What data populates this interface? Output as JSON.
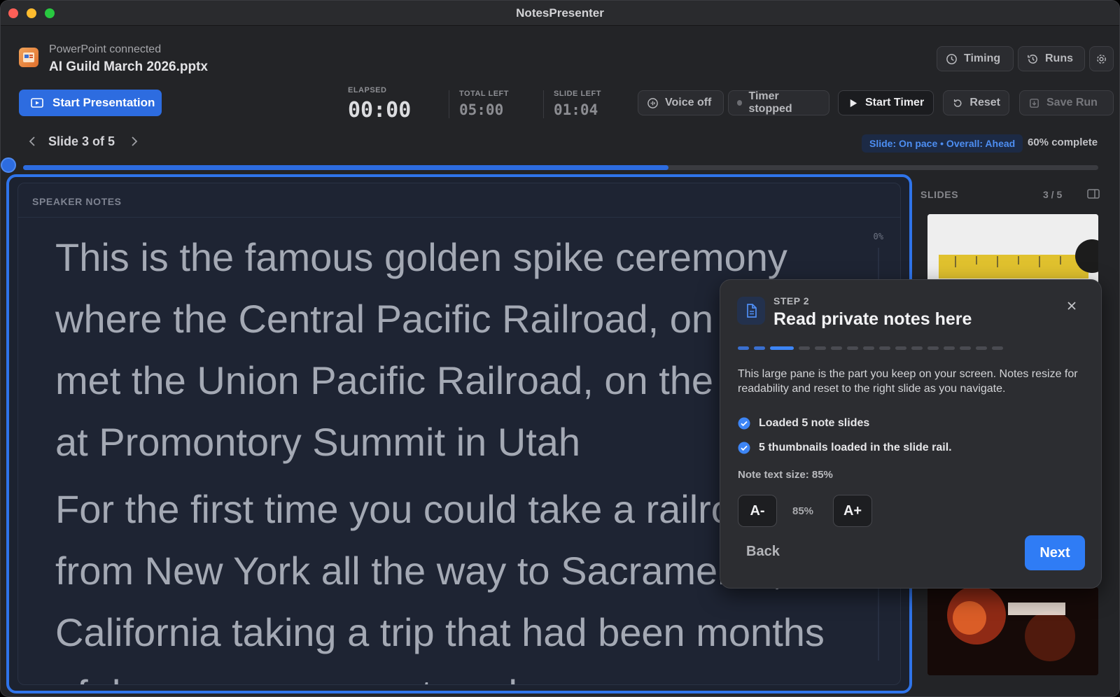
{
  "window": {
    "title": "NotesPresenter"
  },
  "header": {
    "connection_status": "PowerPoint connected",
    "file_name": "AI Guild March 2026.pptx",
    "start_presentation_label": "Start Presentation",
    "timing_label": "Timing",
    "runs_label": "Runs"
  },
  "timers": {
    "elapsed_label": "ELAPSED",
    "elapsed_value": "00:00",
    "total_left_label": "TOTAL LEFT",
    "total_left_value": "05:00",
    "slide_left_label": "SLIDE LEFT",
    "slide_left_value": "01:04"
  },
  "controls": {
    "voice_label": "Voice off",
    "timer_status": "Timer stopped",
    "start_timer_label": "Start Timer",
    "reset_label": "Reset",
    "save_run_label": "Save Run"
  },
  "navigation": {
    "slide_counter": "Slide 3 of 5",
    "pace_status": "Slide: On pace • Overall: Ahead",
    "complete_text": "60% complete",
    "progress_fraction": 0.6
  },
  "notes": {
    "title": "SPEAKER NOTES",
    "scroll_percent": "0%",
    "paragraphs": [
      "This is the famous golden spike ceremony where the Central Pacific Railroad, on the left, met the Union Pacific Railroad, on the right, at Promontory Summit in Utah",
      "For the first time you could take a railroad from New York all the way to Sacramento, California taking a trip that had been months of dangerous wagon travel"
    ]
  },
  "slides_rail": {
    "title": "SLIDES",
    "count": "3 / 5"
  },
  "tutorial": {
    "step_label": "STEP 2",
    "title": "Read private notes here",
    "total_steps": 16,
    "current_step": 3,
    "description": "This large pane is the part you keep on your screen. Notes resize for readability and reset to the right slide as you navigate.",
    "checks": [
      "Loaded 5 note slides",
      "5 thumbnails loaded in the slide rail."
    ],
    "size_label": "Note text size: 85%",
    "decrease_label": "A-",
    "size_value": "85%",
    "increase_label": "A+",
    "back_label": "Back",
    "next_label": "Next"
  },
  "colors": {
    "accent": "#2d6ce0",
    "next_button": "#2f7cf5",
    "pace_text": "#4d8ef2"
  }
}
